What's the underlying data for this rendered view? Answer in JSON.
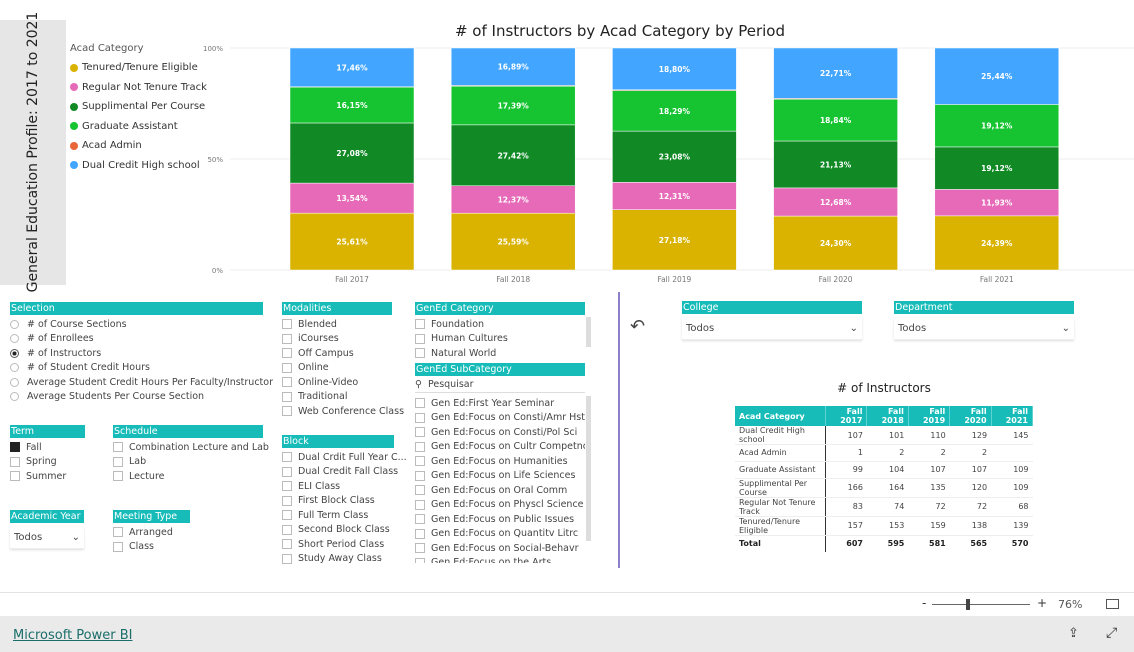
{
  "page_title": "General Education Profile: 2017 to 2021",
  "chart_data": {
    "type": "bar",
    "stacked": "percent",
    "title": "# of Instructors by Acad Category by Period",
    "categories": [
      "Fall 2017",
      "Fall 2018",
      "Fall 2019",
      "Fall 2020",
      "Fall 2021"
    ],
    "ylim": [
      0,
      100
    ],
    "yticks": [
      "0%",
      "50%",
      "100%"
    ],
    "legend_title": "Acad Category",
    "legend_position": "left",
    "grid": true,
    "series": [
      {
        "name": "Tenured/Tenure Eligible",
        "color": "#d9b300",
        "values": [
          25.61,
          25.59,
          27.18,
          24.3,
          24.39
        ],
        "labels": [
          "25,61%",
          "25,59%",
          "27,18%",
          "24,30%",
          "24,39%"
        ]
      },
      {
        "name": "Regular Not Tenure Track",
        "color": "#e66ab8",
        "values": [
          13.54,
          12.37,
          12.31,
          12.68,
          11.93
        ],
        "labels": [
          "13,54%",
          "12,37%",
          "12,31%",
          "12,68%",
          "11,93%"
        ]
      },
      {
        "name": "Supplimental Per Course",
        "color": "#118a26",
        "values": [
          27.08,
          27.42,
          23.08,
          21.13,
          19.12
        ],
        "labels": [
          "27,08%",
          "27,42%",
          "23,08%",
          "21,13%",
          "19,12%"
        ]
      },
      {
        "name": "Graduate Assistant",
        "color": "#16c432",
        "values": [
          16.15,
          17.39,
          18.29,
          18.84,
          19.12
        ],
        "labels": [
          "16,15%",
          "17,39%",
          "18,29%",
          "18,84%",
          "19,12%"
        ]
      },
      {
        "name": "Acad Admin",
        "color": "#e8663a",
        "values": [
          0.16,
          0.34,
          0.34,
          0.35,
          0
        ],
        "labels": [
          "",
          "",
          "",
          "",
          ""
        ]
      },
      {
        "name": "Dual Credit High school",
        "color": "#42a5ff",
        "values": [
          17.46,
          16.89,
          18.8,
          22.71,
          25.44
        ],
        "labels": [
          "17,46%",
          "16,89%",
          "18,80%",
          "22,71%",
          "25,44%"
        ]
      }
    ]
  },
  "selection": {
    "title": "Selection",
    "selected": 2,
    "options": [
      "# of Course Sections",
      "# of Enrollees",
      "# of Instructors",
      "# of Student Credit Hours",
      "Average Student Credit Hours Per Faculty/Instructor",
      "Average Students Per Course Section"
    ]
  },
  "term": {
    "title": "Term",
    "options": [
      {
        "label": "Fall",
        "checked": true
      },
      {
        "label": "Spring",
        "checked": false
      },
      {
        "label": "Summer",
        "checked": false
      }
    ]
  },
  "schedule": {
    "title": "Schedule",
    "options": [
      "Combination Lecture and Lab",
      "Lab",
      "Lecture"
    ]
  },
  "academic_year": {
    "title": "Academic Year",
    "value": "Todos"
  },
  "meeting_type": {
    "title": "Meeting Type",
    "options": [
      "Arranged",
      "Class"
    ]
  },
  "modalities": {
    "title": "Modalities",
    "options": [
      "Blended",
      "iCourses",
      "Off Campus",
      "Online",
      "Online-Video",
      "Traditional",
      "Web Conference Class"
    ]
  },
  "block": {
    "title": "Block",
    "options": [
      "Dual Crdit Full Year C...",
      "Dual Credit Fall Class",
      "ELI Class",
      "First Block Class",
      "Full Term Class",
      "Second Block Class",
      "Short Period Class",
      "Study Away Class"
    ]
  },
  "gened_category": {
    "title": "GenEd Category",
    "options": [
      "Foundation",
      "Human Cultures",
      "Natural World"
    ]
  },
  "gened_subcategory": {
    "title": "GenEd SubCategory",
    "search_placeholder": "Pesquisar",
    "options": [
      "Gen Ed:First Year Seminar",
      "Gen Ed:Focus on Consti/Amr Hst",
      "Gen Ed:Focus on Consti/Pol Sci",
      "Gen Ed:Focus on Cultr Competnc",
      "Gen Ed:Focus on Humanities",
      "Gen Ed:Focus on Life Sciences",
      "Gen Ed:Focus on Oral Comm",
      "Gen Ed:Focus on Physcl Science",
      "Gen Ed:Focus on Public Issues",
      "Gen Ed:Focus on Quantitv Litrc",
      "Gen Ed:Focus on Social-Behavr",
      "Gen Ed:Focus on the Arts"
    ]
  },
  "college": {
    "title": "College",
    "value": "Todos"
  },
  "department": {
    "title": "Department",
    "value": "Todos"
  },
  "matrix": {
    "title": "# of Instructors",
    "headers": [
      "Acad Category",
      "Fall 2017",
      "Fall 2018",
      "Fall 2019",
      "Fall 2020",
      "Fall 2021"
    ],
    "rows": [
      [
        "Dual Credit High school",
        "107",
        "101",
        "110",
        "129",
        "145"
      ],
      [
        "Acad Admin",
        "1",
        "2",
        "2",
        "2",
        ""
      ],
      [
        "Graduate Assistant",
        "99",
        "104",
        "107",
        "107",
        "109"
      ],
      [
        "Supplimental Per Course",
        "166",
        "164",
        "135",
        "120",
        "109"
      ],
      [
        "Regular Not Tenure Track",
        "83",
        "74",
        "72",
        "72",
        "68"
      ],
      [
        "Tenured/Tenure Eligible",
        "157",
        "153",
        "159",
        "138",
        "139"
      ],
      [
        "Total",
        "607",
        "595",
        "581",
        "565",
        "570"
      ]
    ]
  },
  "zoom": {
    "minus": "-",
    "plus": "+",
    "value": "76%",
    "level": 76
  },
  "footer": {
    "brand": "Microsoft Power BI"
  }
}
